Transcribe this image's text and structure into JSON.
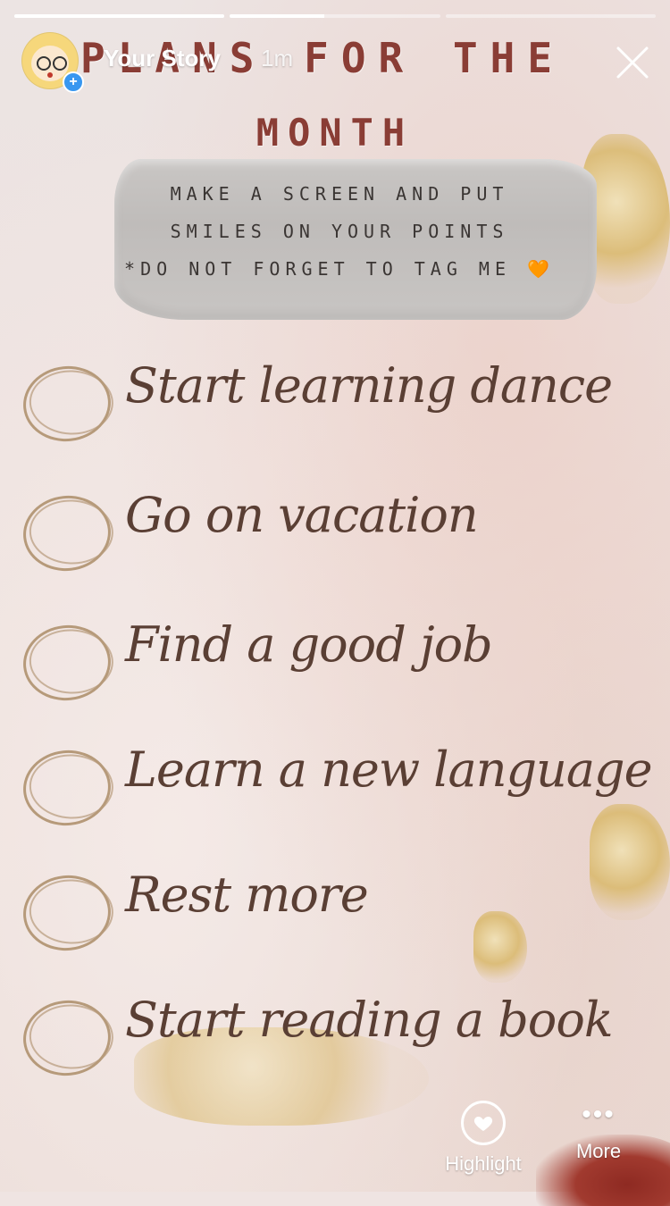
{
  "story": {
    "progress": [
      1.0,
      0.45,
      0.0
    ]
  },
  "header": {
    "username": "Your Story",
    "time": "1m",
    "add_badge": "+"
  },
  "title": {
    "line1": "PLANS FOR THE",
    "line2": "MONTH"
  },
  "note": {
    "line1": "MAKE A SCREEN AND PUT",
    "line2": "SMILES ON YOUR POINTS",
    "line3": "*DO NOT FORGET TO TAG ME 🧡"
  },
  "checklist": [
    {
      "label": "Start learning dance"
    },
    {
      "label": "Go on vacation"
    },
    {
      "label": "Find a good job"
    },
    {
      "label": "Learn a new language"
    },
    {
      "label": "Rest more"
    },
    {
      "label": "Start reading a book"
    }
  ],
  "footer": {
    "highlight_label": "Highlight",
    "more_label": "More",
    "more_icon": "•••"
  },
  "icons": {
    "close": "close-icon",
    "highlight": "heart-icon",
    "more": "more-dots-icon"
  },
  "colors": {
    "accent": "#3897f0",
    "title_red": "#8a3d35",
    "script_brown": "#5a3f34"
  }
}
